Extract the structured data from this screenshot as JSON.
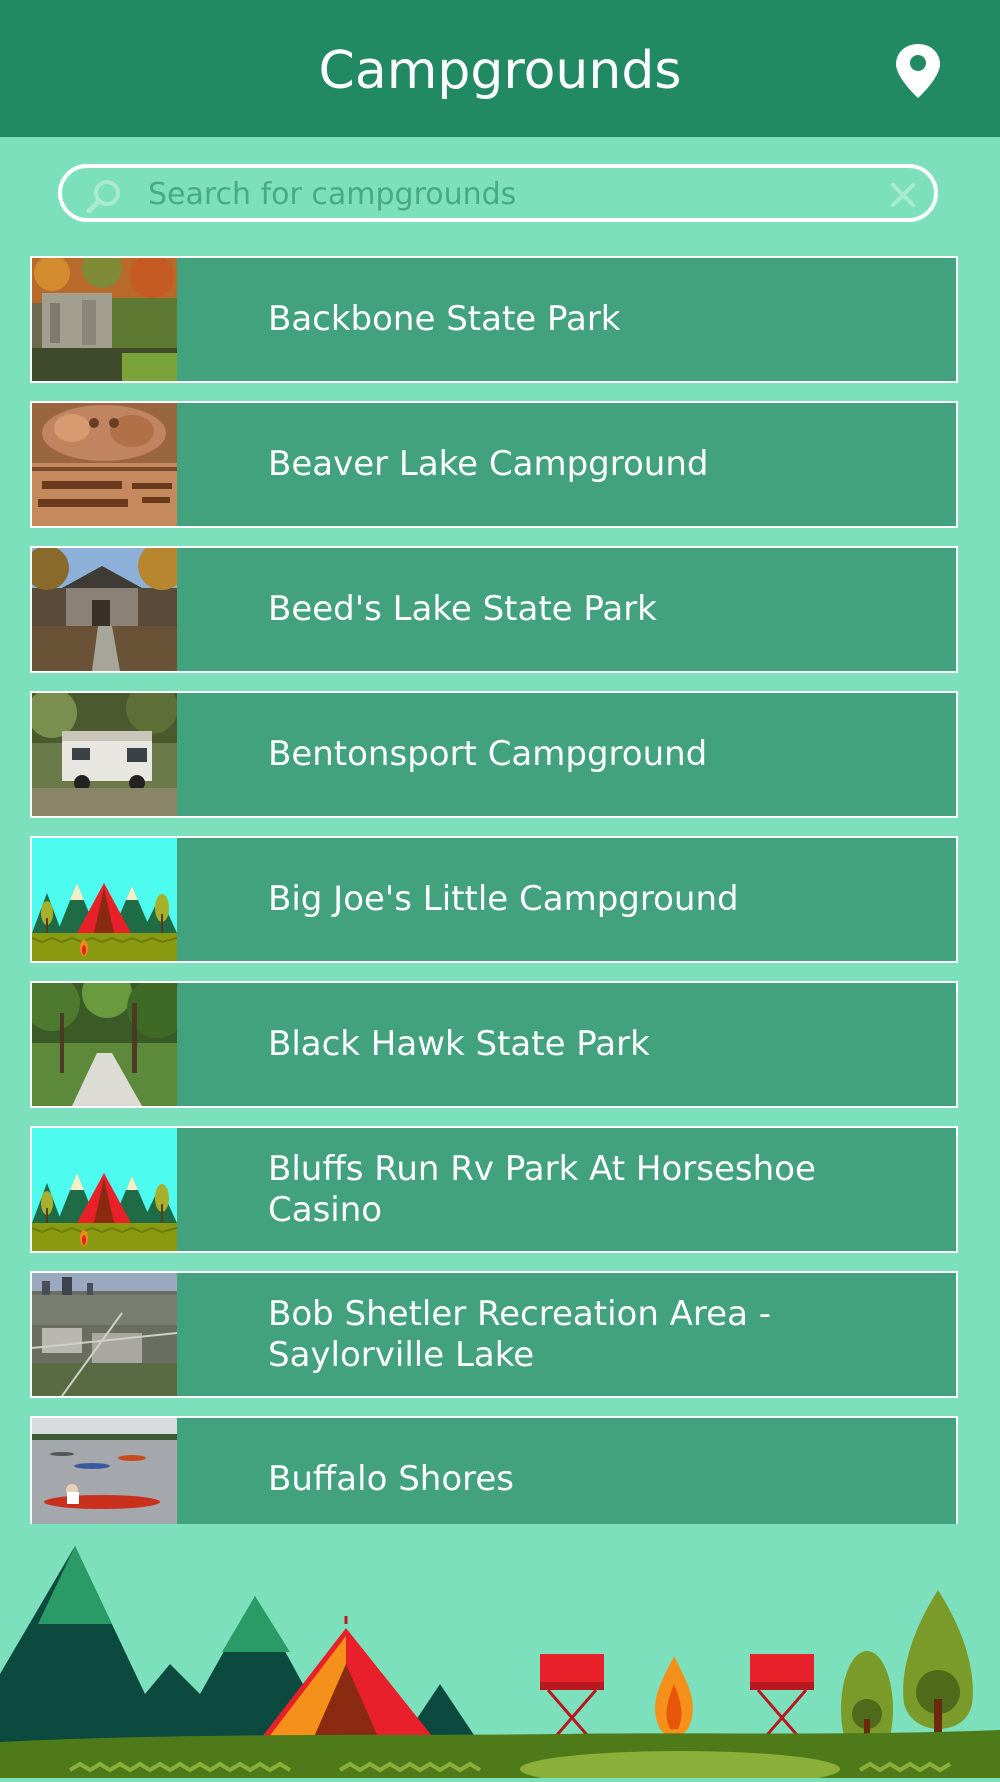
{
  "header": {
    "title": "Campgrounds",
    "location_icon": "map-pin-icon"
  },
  "search": {
    "placeholder": "Search for campgrounds",
    "value": "",
    "search_icon": "magnifier-icon",
    "clear_icon": "close-icon"
  },
  "campgrounds": [
    {
      "name": "Backbone State Park",
      "thumbnail": "photo-limestone-bluff"
    },
    {
      "name": "Beaver Lake Campground",
      "thumbnail": "photo-carved-wood-sign"
    },
    {
      "name": "Beed's Lake State Park",
      "thumbnail": "photo-stone-shelter"
    },
    {
      "name": "Bentonsport Campground",
      "thumbnail": "photo-rv-camper"
    },
    {
      "name": "Big Joe's Little Campground",
      "thumbnail": "tent-illustration"
    },
    {
      "name": "Black Hawk State Park",
      "thumbnail": "photo-forest-path"
    },
    {
      "name": "Bluffs Run Rv Park At Horseshoe Casino",
      "thumbnail": "tent-illustration"
    },
    {
      "name": "Bob Shetler Recreation Area - Saylorville Lake",
      "thumbnail": "photo-aerial-city"
    },
    {
      "name": "Buffalo Shores",
      "thumbnail": "photo-kayaks"
    }
  ],
  "colors": {
    "header": "#228a62",
    "background": "#7de0bc",
    "row": "#42a27e",
    "text": "#ffffff"
  }
}
